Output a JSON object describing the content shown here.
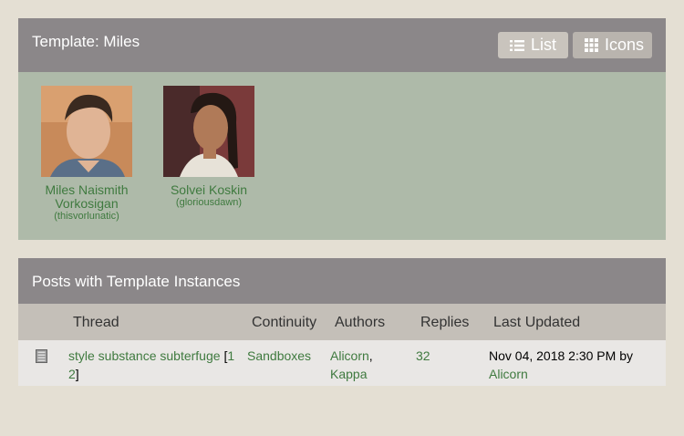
{
  "template": {
    "title": "Template: Miles",
    "view_list_label": "List",
    "view_icons_label": "Icons",
    "characters": [
      {
        "name": "Miles Naismith Vorkosigan",
        "handle": "(thisvorlunatic)"
      },
      {
        "name": "Solvei Koskin",
        "handle": "(gloriousdawn)"
      }
    ]
  },
  "posts": {
    "title": "Posts with Template Instances",
    "columns": [
      "Thread",
      "Continuity",
      "Authors",
      "Replies",
      "Last Updated"
    ],
    "rows": [
      {
        "thread": "style substance subterfuge",
        "page_open": "[",
        "page1": "1",
        "page2": "2",
        "page_close": "]",
        "continuity": "Sandboxes",
        "author1": "Alicorn",
        "author_sep": ",",
        "author2": "Kappa",
        "replies": "32",
        "updated": "Nov 04, 2018 2:30 PM by",
        "updated_by": "Alicorn"
      }
    ]
  },
  "colors": {
    "header_bg": "#8b8789",
    "icons_bg": "#aebaa9",
    "link": "#3f7a3f",
    "page_bg": "#e4dfd3"
  }
}
